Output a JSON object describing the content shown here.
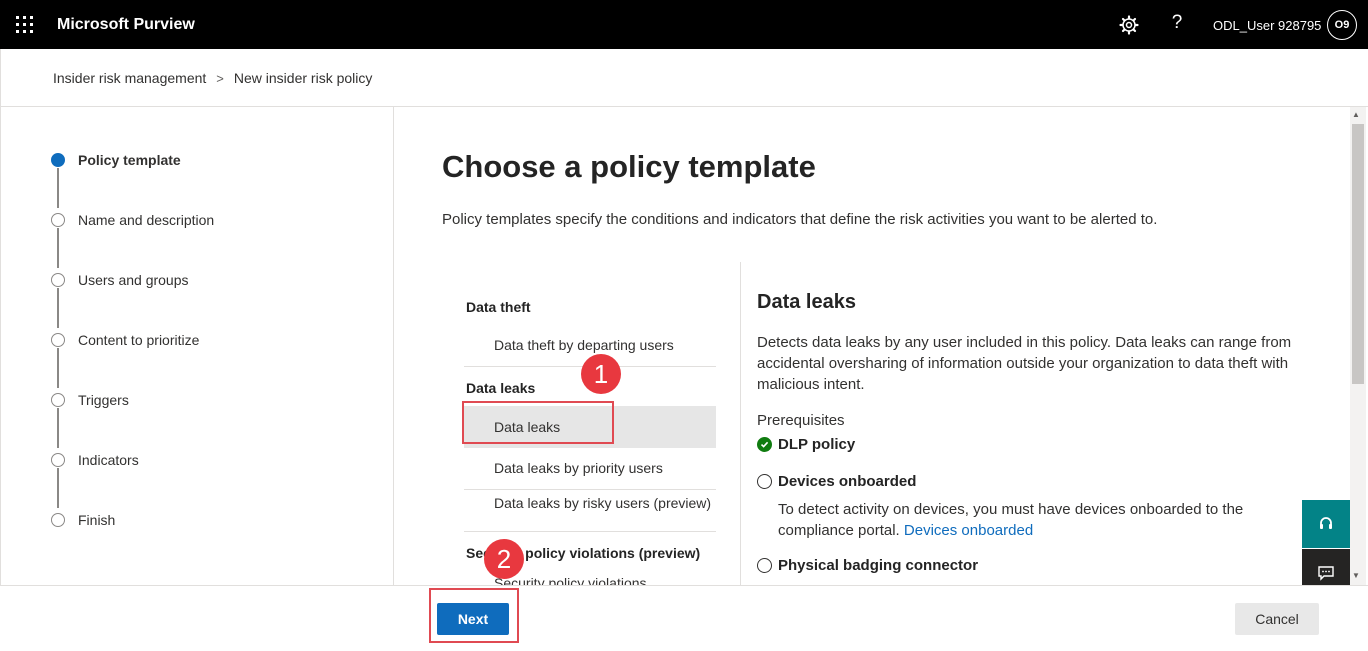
{
  "header": {
    "brand": "Microsoft Purview",
    "username": "ODL_User 928795",
    "avatar_initials": "O9",
    "icons": [
      "app-launcher-icon",
      "settings-gear-icon",
      "help-icon"
    ]
  },
  "breadcrumb": {
    "items": [
      "Insider risk management",
      "New insider risk policy"
    ]
  },
  "stepper": {
    "steps": [
      {
        "label": "Policy template",
        "active": true
      },
      {
        "label": "Name and description",
        "active": false
      },
      {
        "label": "Users and groups",
        "active": false
      },
      {
        "label": "Content to prioritize",
        "active": false
      },
      {
        "label": "Triggers",
        "active": false
      },
      {
        "label": "Indicators",
        "active": false
      },
      {
        "label": "Finish",
        "active": false
      }
    ]
  },
  "main": {
    "title": "Choose a policy template",
    "description": "Policy templates specify the conditions and indicators that define the risk activities you want to be alerted to."
  },
  "templates": {
    "categories": [
      {
        "name": "Data theft",
        "items": [
          "Data theft by departing users"
        ]
      },
      {
        "name": "Data leaks",
        "items": [
          "Data leaks",
          "Data leaks by priority users",
          "Data leaks by risky users (preview)"
        ]
      },
      {
        "name": "Security policy violations (preview)",
        "items": [
          "Security policy violations"
        ]
      }
    ],
    "selected": "Data leaks"
  },
  "detail": {
    "title": "Data leaks",
    "description": "Detects data leaks by any user included in this policy. Data leaks can range from accidental oversharing of information outside your organization to data theft with malicious intent.",
    "prerequisites_heading": "Prerequisites",
    "prerequisites": [
      {
        "label": "DLP policy",
        "met": true
      },
      {
        "label": "Devices onboarded",
        "met": false
      },
      {
        "label": "Physical badging connector",
        "met": false
      }
    ],
    "devices_note": "To detect activity on devices, you must have devices onboarded to the compliance portal.",
    "devices_link": "Devices onboarded"
  },
  "footer": {
    "next_label": "Next",
    "cancel_label": "Cancel"
  },
  "annotations": {
    "callout_1": "1",
    "callout_2": "2"
  },
  "colors": {
    "accent": "#0f6cbd",
    "topbar": "#000000",
    "success": "#107c10",
    "callout": "#e8383f",
    "help_fab": "#038387"
  }
}
